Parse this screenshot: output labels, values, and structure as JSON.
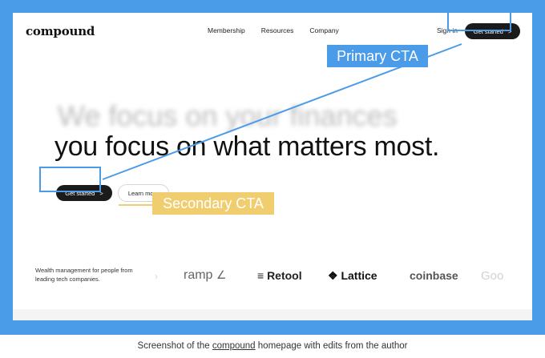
{
  "site": {
    "logo": "compound",
    "nav": [
      "Membership",
      "Resources",
      "Company"
    ],
    "sign_in": "Sign in",
    "cta_top": "Get started",
    "cta_top_chevron": ">"
  },
  "hero": {
    "ghost_line": "We focus on your finances",
    "headline": "you focus on what matters most.",
    "primary_button": "Get started",
    "primary_chevron": ">",
    "secondary_button": "Learn more"
  },
  "annotations": {
    "primary_label": "Primary CTA",
    "secondary_label": "Secondary CTA",
    "primary_color": "#4a9be8",
    "secondary_color": "#f0cd6e"
  },
  "logos_section": {
    "tagline": "Wealth management for people from leading tech companies.",
    "logos": [
      "ramp",
      "Retool",
      "Lattice",
      "coinbase",
      "Goo"
    ]
  },
  "caption": {
    "prefix": "Screenshot of the ",
    "link": "compound",
    "suffix": " homepage with edits from the author"
  }
}
